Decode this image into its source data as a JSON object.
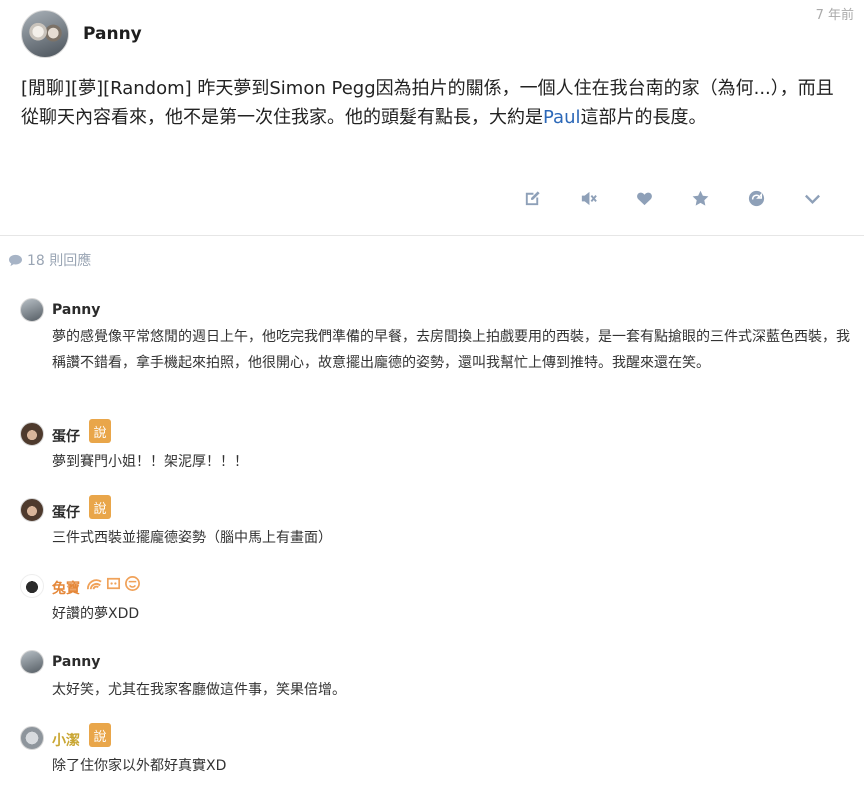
{
  "post": {
    "author": "Panny",
    "time": "7 年前",
    "body_lines": {
      "part1": "[閒聊][夢][Random] 昨天夢到Simon Pegg因為拍片的關係，一個人住在我台南的家（為何...），而且從聊天內容看來，他不是第一次住我家。他的頭髮有點長，大約是",
      "mention": "Paul",
      "part2": "這部片的長度。"
    },
    "actions": [
      "edit-icon",
      "mute-icon",
      "heart-icon",
      "star-icon",
      "share-icon",
      "chevron-down-icon"
    ]
  },
  "reply_count": "18 則回應",
  "comments": [
    {
      "author": "Panny",
      "text": "夢的感覺像平常悠閒的週日上午，他吃完我們準備的早餐，去房間換上拍戲要用的西裝，是一套有點搶眼的三件式深藍色西裝，我稱讚不錯看，拿手機起來拍照，他很開心，故意擺出龐德的姿勢，還叫我幫忙上傳到推特。我醒來還在笑。"
    },
    {
      "author": "蛋仔",
      "badge": "說",
      "text": "夢到賽門小姐！！架泥厚！！！"
    },
    {
      "author": "蛋仔",
      "badge": "說",
      "text": "三件式西裝並擺龐德姿勢（腦中馬上有畫面）"
    },
    {
      "author": "兔寶",
      "text": "好讚的夢XDD"
    },
    {
      "author": "Panny",
      "text": "太好笑，尤其在我家客廳做這件事，笑果倍增。"
    },
    {
      "author": "小潔",
      "badge": "說",
      "text": "除了住你家以外都好真實XD"
    }
  ],
  "colors": {
    "mention": "#2c68b8",
    "badge": "#e9a64a",
    "action_icon": "#8ea0b8",
    "orange_name": "#e5883a",
    "gold_name": "#c9a633"
  }
}
